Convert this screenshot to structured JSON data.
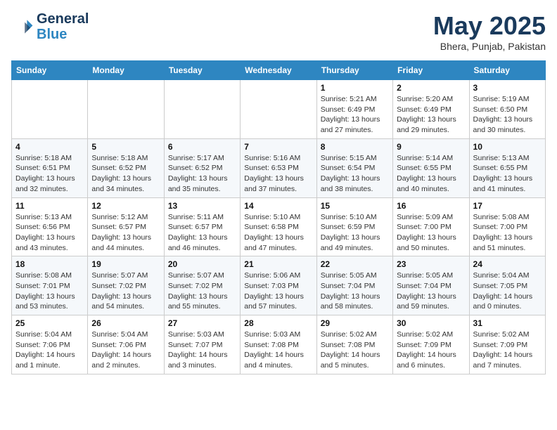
{
  "logo": {
    "line1": "General",
    "line2": "Blue"
  },
  "title": "May 2025",
  "subtitle": "Bhera, Punjab, Pakistan",
  "days_of_week": [
    "Sunday",
    "Monday",
    "Tuesday",
    "Wednesday",
    "Thursday",
    "Friday",
    "Saturday"
  ],
  "weeks": [
    [
      {
        "day": "",
        "info": ""
      },
      {
        "day": "",
        "info": ""
      },
      {
        "day": "",
        "info": ""
      },
      {
        "day": "",
        "info": ""
      },
      {
        "day": "1",
        "info": "Sunrise: 5:21 AM\nSunset: 6:49 PM\nDaylight: 13 hours\nand 27 minutes."
      },
      {
        "day": "2",
        "info": "Sunrise: 5:20 AM\nSunset: 6:49 PM\nDaylight: 13 hours\nand 29 minutes."
      },
      {
        "day": "3",
        "info": "Sunrise: 5:19 AM\nSunset: 6:50 PM\nDaylight: 13 hours\nand 30 minutes."
      }
    ],
    [
      {
        "day": "4",
        "info": "Sunrise: 5:18 AM\nSunset: 6:51 PM\nDaylight: 13 hours\nand 32 minutes."
      },
      {
        "day": "5",
        "info": "Sunrise: 5:18 AM\nSunset: 6:52 PM\nDaylight: 13 hours\nand 34 minutes."
      },
      {
        "day": "6",
        "info": "Sunrise: 5:17 AM\nSunset: 6:52 PM\nDaylight: 13 hours\nand 35 minutes."
      },
      {
        "day": "7",
        "info": "Sunrise: 5:16 AM\nSunset: 6:53 PM\nDaylight: 13 hours\nand 37 minutes."
      },
      {
        "day": "8",
        "info": "Sunrise: 5:15 AM\nSunset: 6:54 PM\nDaylight: 13 hours\nand 38 minutes."
      },
      {
        "day": "9",
        "info": "Sunrise: 5:14 AM\nSunset: 6:55 PM\nDaylight: 13 hours\nand 40 minutes."
      },
      {
        "day": "10",
        "info": "Sunrise: 5:13 AM\nSunset: 6:55 PM\nDaylight: 13 hours\nand 41 minutes."
      }
    ],
    [
      {
        "day": "11",
        "info": "Sunrise: 5:13 AM\nSunset: 6:56 PM\nDaylight: 13 hours\nand 43 minutes."
      },
      {
        "day": "12",
        "info": "Sunrise: 5:12 AM\nSunset: 6:57 PM\nDaylight: 13 hours\nand 44 minutes."
      },
      {
        "day": "13",
        "info": "Sunrise: 5:11 AM\nSunset: 6:57 PM\nDaylight: 13 hours\nand 46 minutes."
      },
      {
        "day": "14",
        "info": "Sunrise: 5:10 AM\nSunset: 6:58 PM\nDaylight: 13 hours\nand 47 minutes."
      },
      {
        "day": "15",
        "info": "Sunrise: 5:10 AM\nSunset: 6:59 PM\nDaylight: 13 hours\nand 49 minutes."
      },
      {
        "day": "16",
        "info": "Sunrise: 5:09 AM\nSunset: 7:00 PM\nDaylight: 13 hours\nand 50 minutes."
      },
      {
        "day": "17",
        "info": "Sunrise: 5:08 AM\nSunset: 7:00 PM\nDaylight: 13 hours\nand 51 minutes."
      }
    ],
    [
      {
        "day": "18",
        "info": "Sunrise: 5:08 AM\nSunset: 7:01 PM\nDaylight: 13 hours\nand 53 minutes."
      },
      {
        "day": "19",
        "info": "Sunrise: 5:07 AM\nSunset: 7:02 PM\nDaylight: 13 hours\nand 54 minutes."
      },
      {
        "day": "20",
        "info": "Sunrise: 5:07 AM\nSunset: 7:02 PM\nDaylight: 13 hours\nand 55 minutes."
      },
      {
        "day": "21",
        "info": "Sunrise: 5:06 AM\nSunset: 7:03 PM\nDaylight: 13 hours\nand 57 minutes."
      },
      {
        "day": "22",
        "info": "Sunrise: 5:05 AM\nSunset: 7:04 PM\nDaylight: 13 hours\nand 58 minutes."
      },
      {
        "day": "23",
        "info": "Sunrise: 5:05 AM\nSunset: 7:04 PM\nDaylight: 13 hours\nand 59 minutes."
      },
      {
        "day": "24",
        "info": "Sunrise: 5:04 AM\nSunset: 7:05 PM\nDaylight: 14 hours\nand 0 minutes."
      }
    ],
    [
      {
        "day": "25",
        "info": "Sunrise: 5:04 AM\nSunset: 7:06 PM\nDaylight: 14 hours\nand 1 minute."
      },
      {
        "day": "26",
        "info": "Sunrise: 5:04 AM\nSunset: 7:06 PM\nDaylight: 14 hours\nand 2 minutes."
      },
      {
        "day": "27",
        "info": "Sunrise: 5:03 AM\nSunset: 7:07 PM\nDaylight: 14 hours\nand 3 minutes."
      },
      {
        "day": "28",
        "info": "Sunrise: 5:03 AM\nSunset: 7:08 PM\nDaylight: 14 hours\nand 4 minutes."
      },
      {
        "day": "29",
        "info": "Sunrise: 5:02 AM\nSunset: 7:08 PM\nDaylight: 14 hours\nand 5 minutes."
      },
      {
        "day": "30",
        "info": "Sunrise: 5:02 AM\nSunset: 7:09 PM\nDaylight: 14 hours\nand 6 minutes."
      },
      {
        "day": "31",
        "info": "Sunrise: 5:02 AM\nSunset: 7:09 PM\nDaylight: 14 hours\nand 7 minutes."
      }
    ]
  ]
}
